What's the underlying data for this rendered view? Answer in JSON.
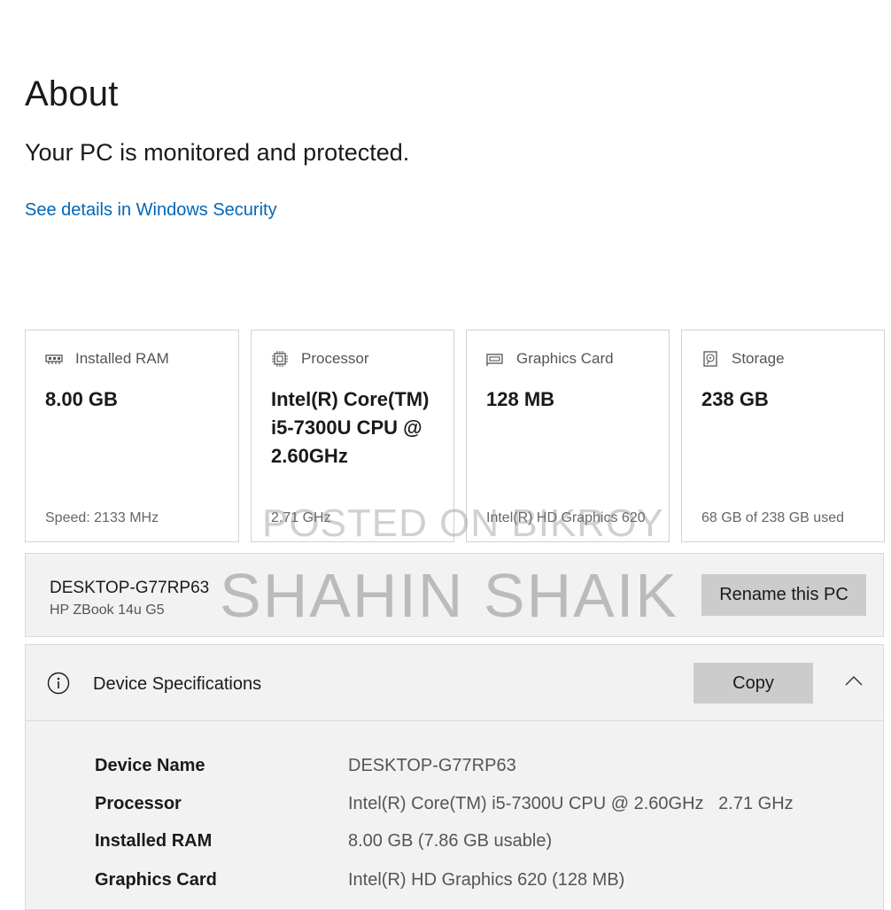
{
  "page": {
    "title": "About",
    "subtitle": "Your PC is monitored and protected.",
    "security_link": "See details in Windows Security"
  },
  "cards": [
    {
      "icon": "memory-icon",
      "label": "Installed RAM",
      "value": "8.00 GB",
      "footer": "Speed: 2133 MHz"
    },
    {
      "icon": "processor-icon",
      "label": "Processor",
      "value": "Intel(R) Core(TM) i5-7300U CPU @ 2.60GHz",
      "footer": "2.71 GHz"
    },
    {
      "icon": "graphics-card-icon",
      "label": "Graphics Card",
      "value": "128 MB",
      "footer": "Intel(R) HD Graphics 620"
    },
    {
      "icon": "storage-icon",
      "label": "Storage",
      "value": "238 GB",
      "footer": "68 GB of 238 GB used"
    }
  ],
  "pc": {
    "name": "DESKTOP-G77RP63",
    "model": "HP ZBook 14u G5",
    "rename_label": "Rename this PC"
  },
  "specs": {
    "title": "Device Specifications",
    "copy_label": "Copy",
    "rows": [
      {
        "key": "Device Name",
        "value": "DESKTOP-G77RP63"
      },
      {
        "key": "Processor",
        "value": "Intel(R) Core(TM) i5-7300U CPU @ 2.60GHz   2.71 GHz"
      },
      {
        "key": "Installed RAM",
        "value": "8.00 GB (7.86 GB usable)"
      },
      {
        "key": "Graphics Card",
        "value": "Intel(R) HD Graphics 620 (128 MB)"
      }
    ]
  },
  "watermarks": {
    "line1": "POSTED ON BIKROY",
    "line2": "SHAHIN SHAIK"
  },
  "colors": {
    "link": "#0067b8",
    "panel_bg": "#f2f2f2",
    "button_bg": "#cccccc"
  }
}
